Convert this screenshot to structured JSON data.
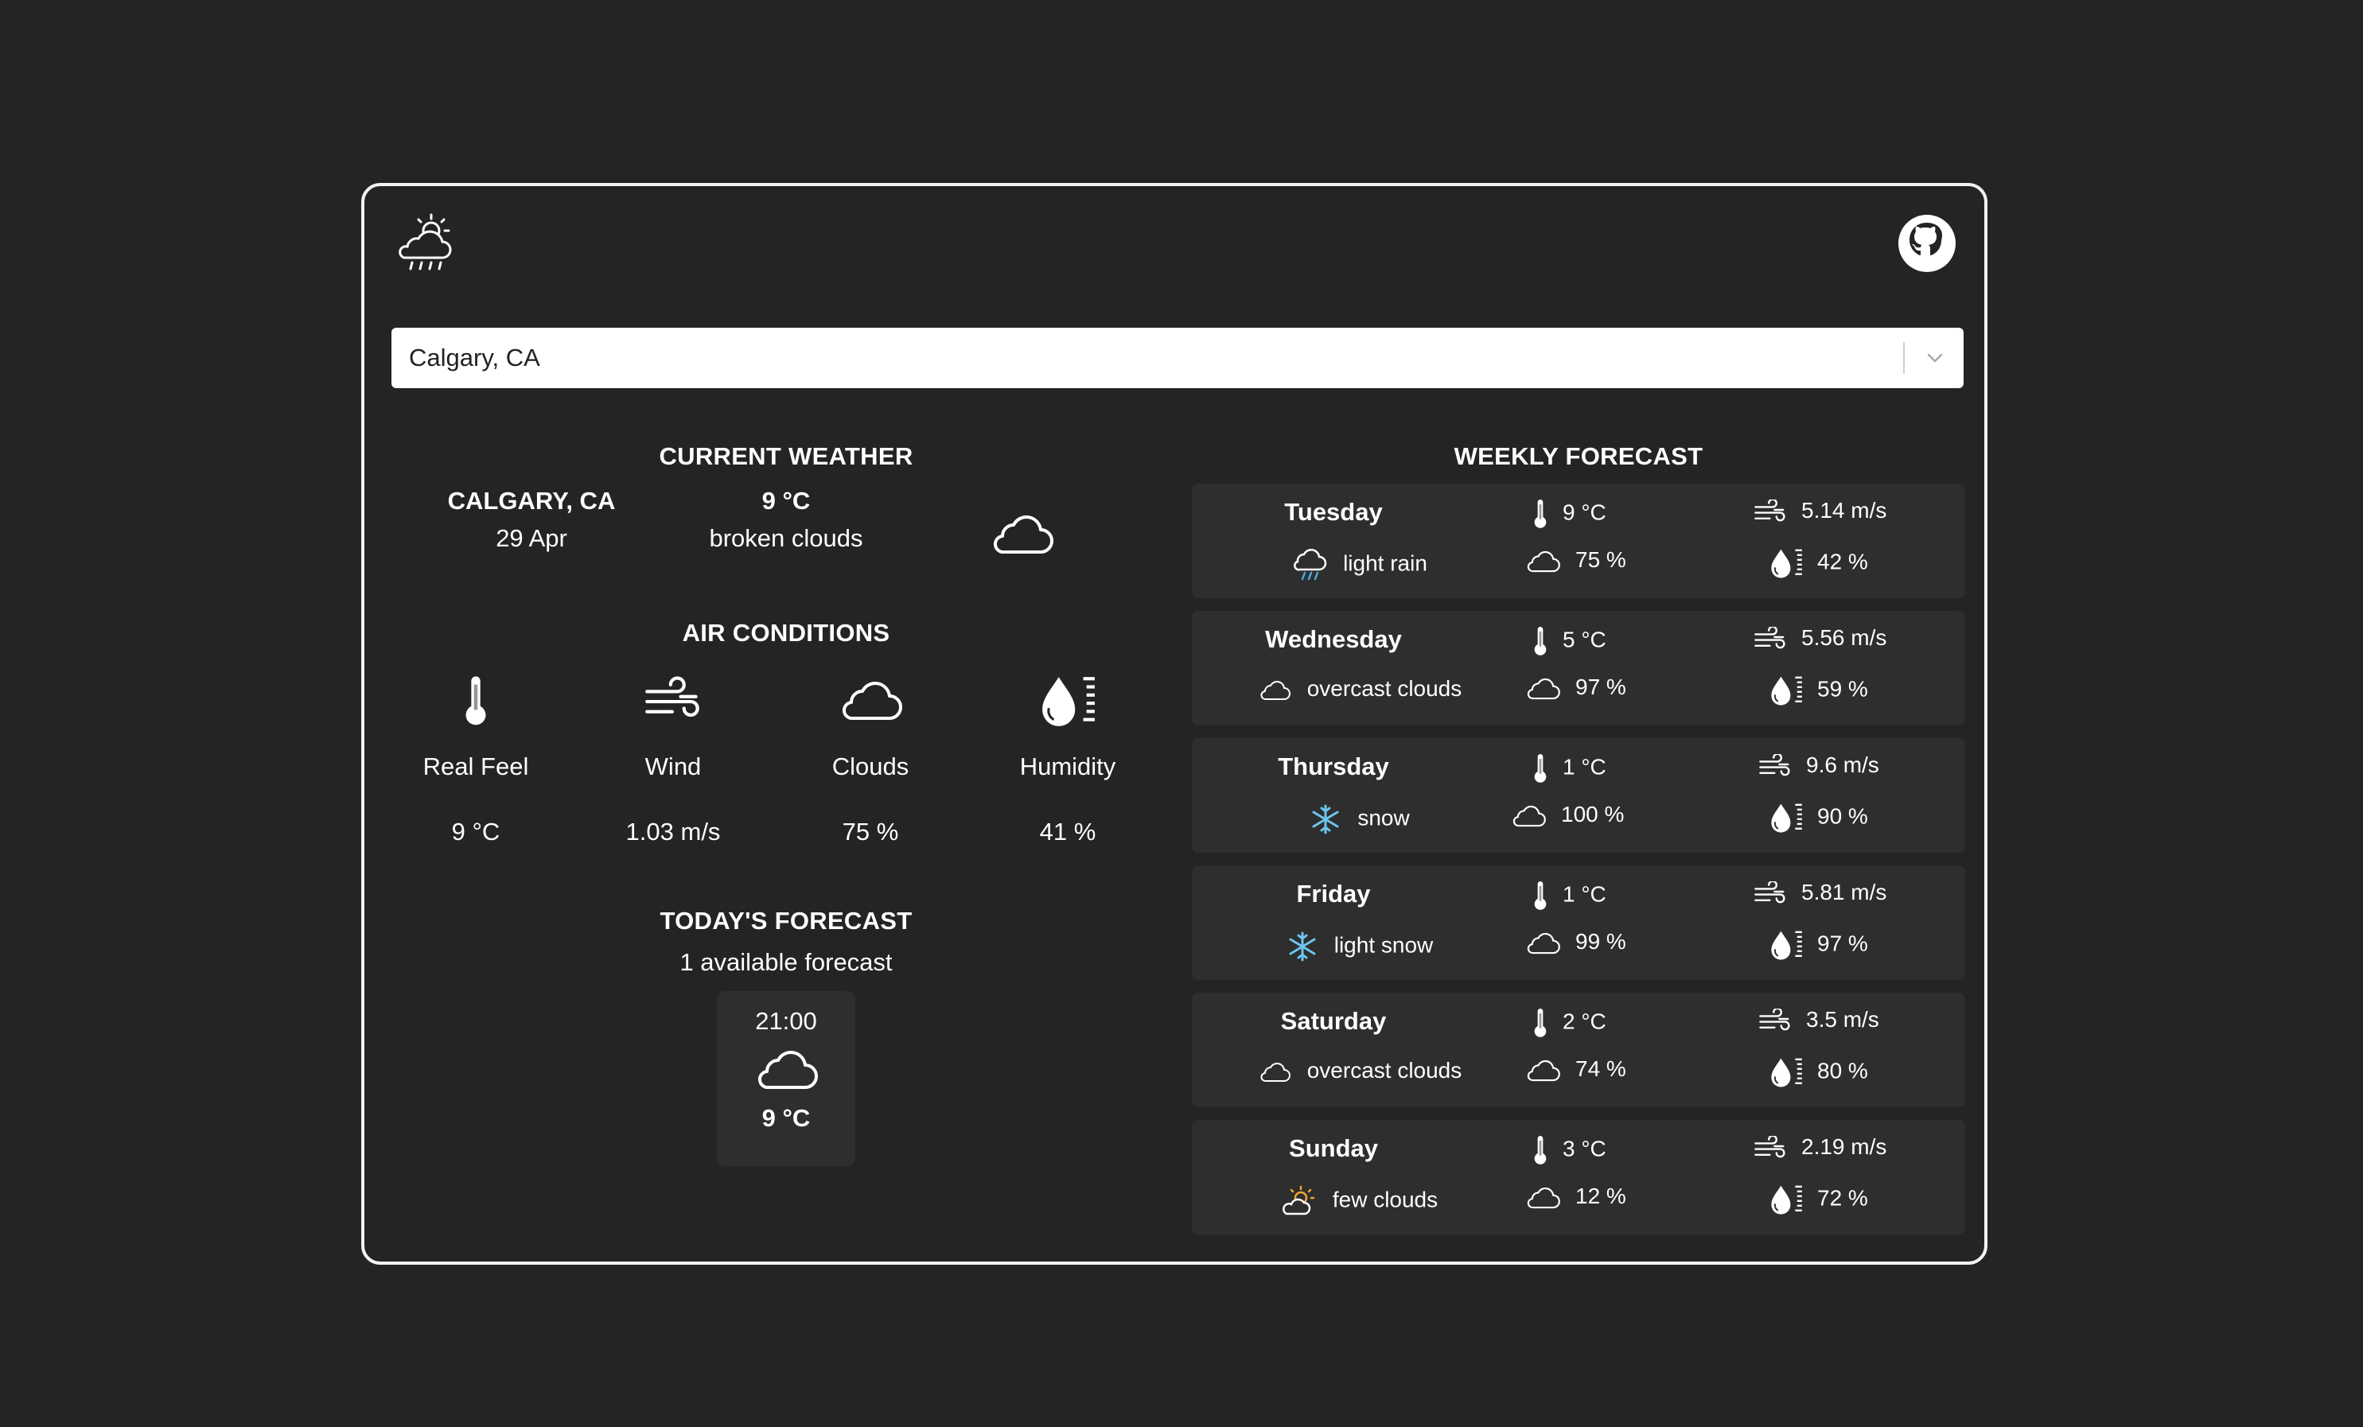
{
  "app": {
    "logo_icon": "cloud-sun-rain-icon",
    "github_icon": "github-icon"
  },
  "search": {
    "value": "Calgary, CA",
    "dropdown_icon": "chevron-down-icon"
  },
  "current_weather": {
    "title": "CURRENT WEATHER",
    "city": "CALGARY, CA",
    "date": "29 Apr",
    "temp": "9 °C",
    "description": "broken clouds",
    "icon": "cloud-icon"
  },
  "air_conditions": {
    "title": "AIR CONDITIONS",
    "items": [
      {
        "label": "Real Feel",
        "value": "9 °C",
        "icon": "thermometer-icon"
      },
      {
        "label": "Wind",
        "value": "1.03 m/s",
        "icon": "wind-icon"
      },
      {
        "label": "Clouds",
        "value": "75 %",
        "icon": "cloud-icon"
      },
      {
        "label": "Humidity",
        "value": "41 %",
        "icon": "humidity-icon"
      }
    ]
  },
  "todays_forecast": {
    "title": "TODAY'S FORECAST",
    "subtitle": "1 available forecast",
    "items": [
      {
        "time": "21:00",
        "temp": "9 °C",
        "icon": "cloud-icon"
      }
    ]
  },
  "weekly_forecast": {
    "title": "WEEKLY FORECAST",
    "days": [
      {
        "day": "Tuesday",
        "description": "light rain",
        "icon": "rain-cloud-icon",
        "temp": "9 °C",
        "clouds": "75 %",
        "wind": "5.14 m/s",
        "humidity": "42 %"
      },
      {
        "day": "Wednesday",
        "description": "overcast clouds",
        "icon": "cloud-icon",
        "temp": "5 °C",
        "clouds": "97 %",
        "wind": "5.56 m/s",
        "humidity": "59 %"
      },
      {
        "day": "Thursday",
        "description": "snow",
        "icon": "snowflake-icon",
        "temp": "1 °C",
        "clouds": "100 %",
        "wind": "9.6 m/s",
        "humidity": "90 %"
      },
      {
        "day": "Friday",
        "description": "light snow",
        "icon": "snowflake-icon",
        "temp": "1 °C",
        "clouds": "99 %",
        "wind": "5.81 m/s",
        "humidity": "97 %"
      },
      {
        "day": "Saturday",
        "description": "overcast clouds",
        "icon": "cloud-icon",
        "temp": "2 °C",
        "clouds": "74 %",
        "wind": "3.5 m/s",
        "humidity": "80 %"
      },
      {
        "day": "Sunday",
        "description": "few clouds",
        "icon": "sun-cloud-icon",
        "temp": "3 °C",
        "clouds": "12 %",
        "wind": "2.19 m/s",
        "humidity": "72 %"
      }
    ]
  },
  "colors": {
    "background": "#242424",
    "card": "#2e2e2e",
    "snow_accent": "#6cc5f0",
    "sun_accent": "#f0a830"
  }
}
